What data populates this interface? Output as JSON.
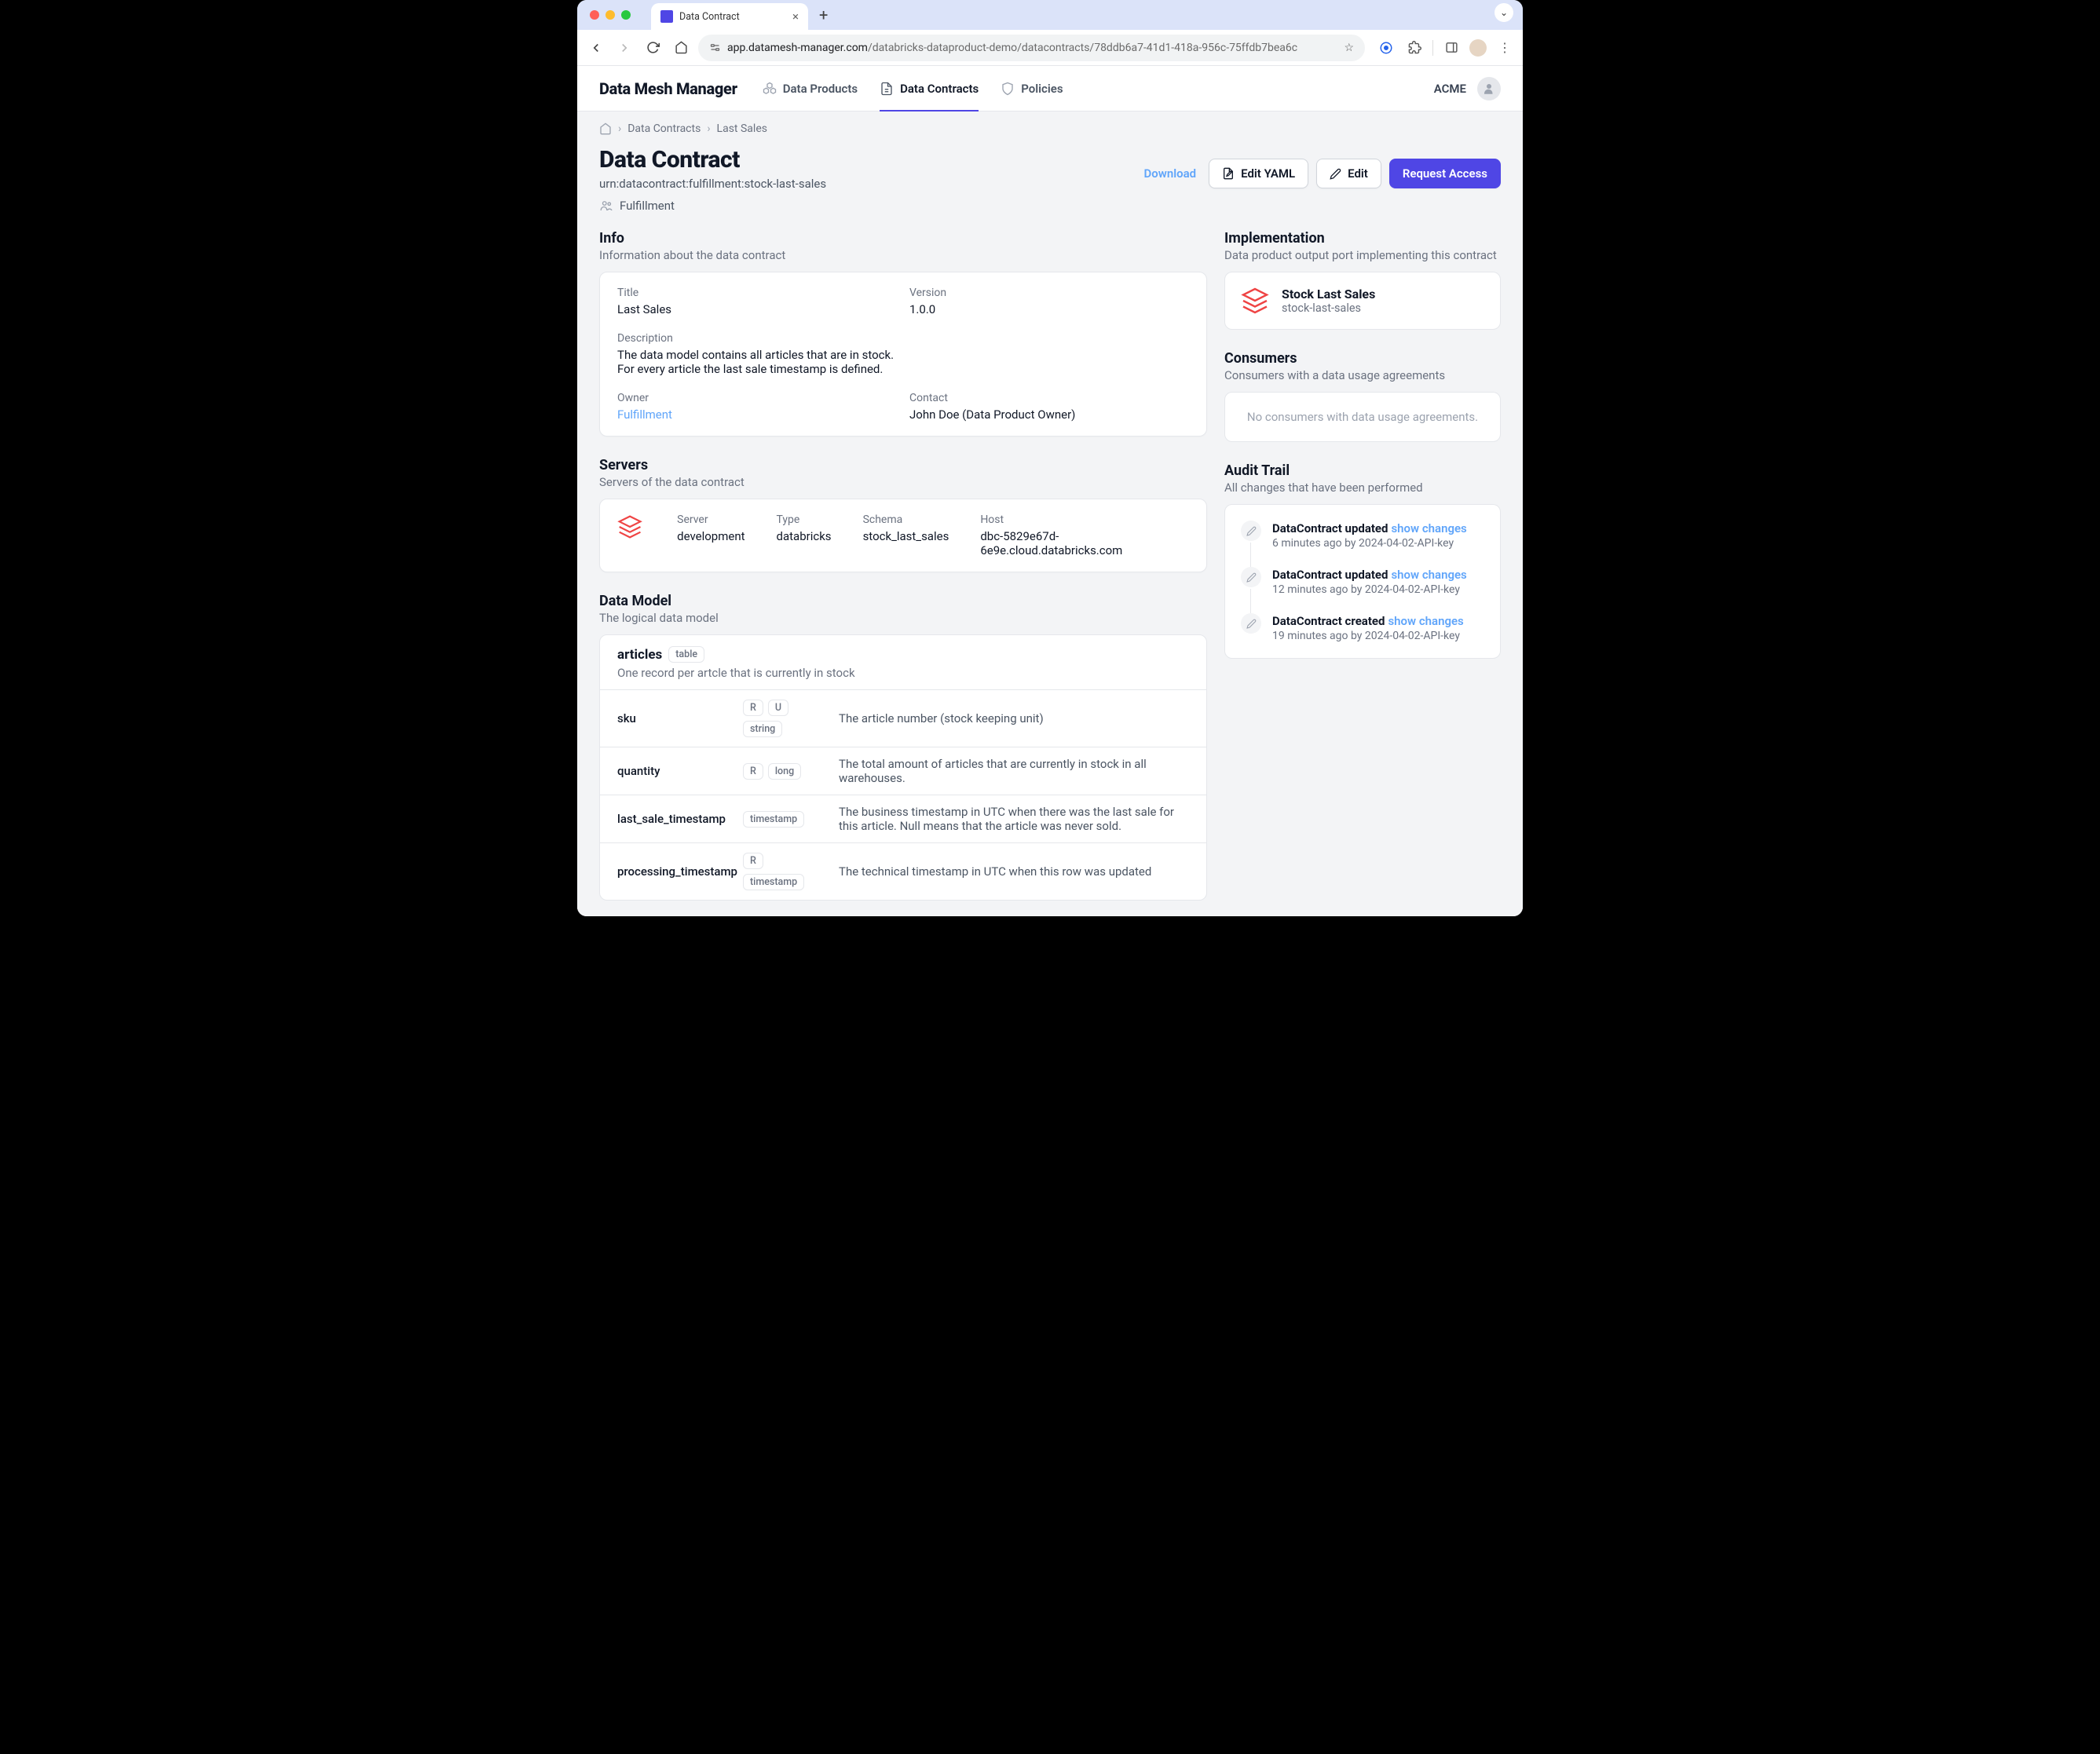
{
  "browser": {
    "tab_title": "Data Contract",
    "url_host": "app.datamesh-manager.com",
    "url_path": "/databricks-dataproduct-demo/datacontracts/78ddb6a7-41d1-418a-956c-75ffdb7bea6c"
  },
  "header": {
    "brand": "Data Mesh Manager",
    "nav": {
      "data_products": "Data Products",
      "data_contracts": "Data Contracts",
      "policies": "Policies"
    },
    "org": "ACME"
  },
  "breadcrumb": {
    "data_contracts": "Data Contracts",
    "current": "Last Sales"
  },
  "page": {
    "title": "Data Contract",
    "urn": "urn:datacontract:fulfillment:stock-last-sales",
    "team": "Fulfillment",
    "actions": {
      "download": "Download",
      "edit_yaml": "Edit YAML",
      "edit": "Edit",
      "request_access": "Request Access"
    }
  },
  "info": {
    "heading": "Info",
    "sub": "Information about the data contract",
    "labels": {
      "title": "Title",
      "version": "Version",
      "description": "Description",
      "owner": "Owner",
      "contact": "Contact"
    },
    "values": {
      "title": "Last Sales",
      "version": "1.0.0",
      "description_l1": "The data model contains all articles that are in stock.",
      "description_l2": "For every article the last sale timestamp is defined.",
      "owner": "Fulfillment",
      "contact": "John Doe (Data Product Owner)"
    }
  },
  "servers": {
    "heading": "Servers",
    "sub": "Servers of the data contract",
    "labels": {
      "server": "Server",
      "type": "Type",
      "schema": "Schema",
      "host": "Host"
    },
    "values": {
      "server": "development",
      "type": "databricks",
      "schema": "stock_last_sales",
      "host": "dbc-5829e67d-6e9e.cloud.databricks.com"
    }
  },
  "model": {
    "heading": "Data Model",
    "sub": "The logical data model",
    "entity": {
      "name": "articles",
      "kind": "table",
      "desc": "One record per artcle that is currently in stock"
    },
    "fields": [
      {
        "name": "sku",
        "badges": [
          "R",
          "U",
          "string"
        ],
        "desc": "The article number (stock keeping unit)"
      },
      {
        "name": "quantity",
        "badges": [
          "R",
          "long"
        ],
        "desc": "The total amount of articles that are currently in stock in all warehouses."
      },
      {
        "name": "last_sale_timestamp",
        "badges": [
          "timestamp"
        ],
        "desc": "The business timestamp in UTC when there was the last sale for this article. Null means that the article was never sold."
      },
      {
        "name": "processing_timestamp",
        "badges": [
          "R",
          "timestamp"
        ],
        "desc": "The technical timestamp in UTC when this row was updated"
      }
    ]
  },
  "impl": {
    "heading": "Implementation",
    "sub": "Data product output port implementing this contract",
    "name": "Stock Last Sales",
    "id": "stock-last-sales"
  },
  "consumers": {
    "heading": "Consumers",
    "sub": "Consumers with a data usage agreements",
    "empty": "No consumers with data usage agreements."
  },
  "audit": {
    "heading": "Audit Trail",
    "sub": "All changes that have been performed",
    "show_changes": "show changes",
    "items": [
      {
        "title": "DataContract updated",
        "meta": "6 minutes ago by 2024-04-02-API-key"
      },
      {
        "title": "DataContract updated",
        "meta": "12 minutes ago by 2024-04-02-API-key"
      },
      {
        "title": "DataContract created",
        "meta": "19 minutes ago by 2024-04-02-API-key"
      }
    ]
  }
}
